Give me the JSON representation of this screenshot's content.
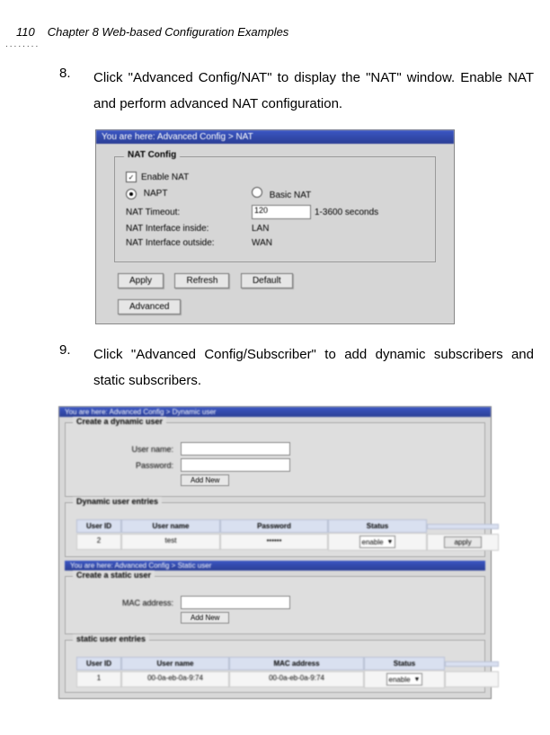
{
  "header": {
    "page_number": "110",
    "chapter": "Chapter 8 Web-based Configuration Examples"
  },
  "step8": {
    "num": "8.",
    "text": "Click \"Advanced Config/NAT\" to display the \"NAT\" window. Enable NAT and perform advanced NAT configuration."
  },
  "step9": {
    "num": "9.",
    "text": "Click \"Advanced Config/Subscriber\" to add dynamic subscribers and static subscribers."
  },
  "nat_panel": {
    "breadcrumb": "You are here: Advanced Config > NAT",
    "legend": "NAT Config",
    "enable_label": "Enable NAT",
    "napt_label": "NAPT",
    "basic_label": "Basic NAT",
    "timeout_label": "NAT Timeout:",
    "timeout_value": "120",
    "timeout_hint": "1-3600 seconds",
    "inside_label": "NAT Interface inside:",
    "inside_value": "LAN",
    "outside_label": "NAT Interface outside:",
    "outside_value": "WAN",
    "apply": "Apply",
    "refresh": "Refresh",
    "default": "Default",
    "advanced": "Advanced"
  },
  "sub_panel": {
    "breadcrumb_top": "You are here: Advanced Config > Dynamic user",
    "dyn_legend": "Create a dynamic user",
    "user_name_label": "User name:",
    "password_label": "Password:",
    "add_new": "Add New",
    "dyn_entries_legend": "Dynamic user entries",
    "head": {
      "userid": "User ID",
      "username": "User name",
      "password": "Password",
      "status": "Status",
      "action": ""
    },
    "dyn_row": {
      "userid": "2",
      "username": "test",
      "password": "••••••",
      "status": "enable",
      "apply": "apply"
    },
    "breadcrumb_static": "You are here: Advanced Config > Static user",
    "static_legend": "Create a static user",
    "mac_label": "MAC address:",
    "static_entries_legend": "static user entries",
    "head2": {
      "userid": "User ID",
      "username": "User name",
      "mac": "MAC address",
      "status": "Status"
    },
    "static_row": {
      "userid": "1",
      "mac1": "00-0a-eb-0a-9:74",
      "mac2": "00-0a-eb-0a-9:74",
      "status": "enable"
    }
  }
}
